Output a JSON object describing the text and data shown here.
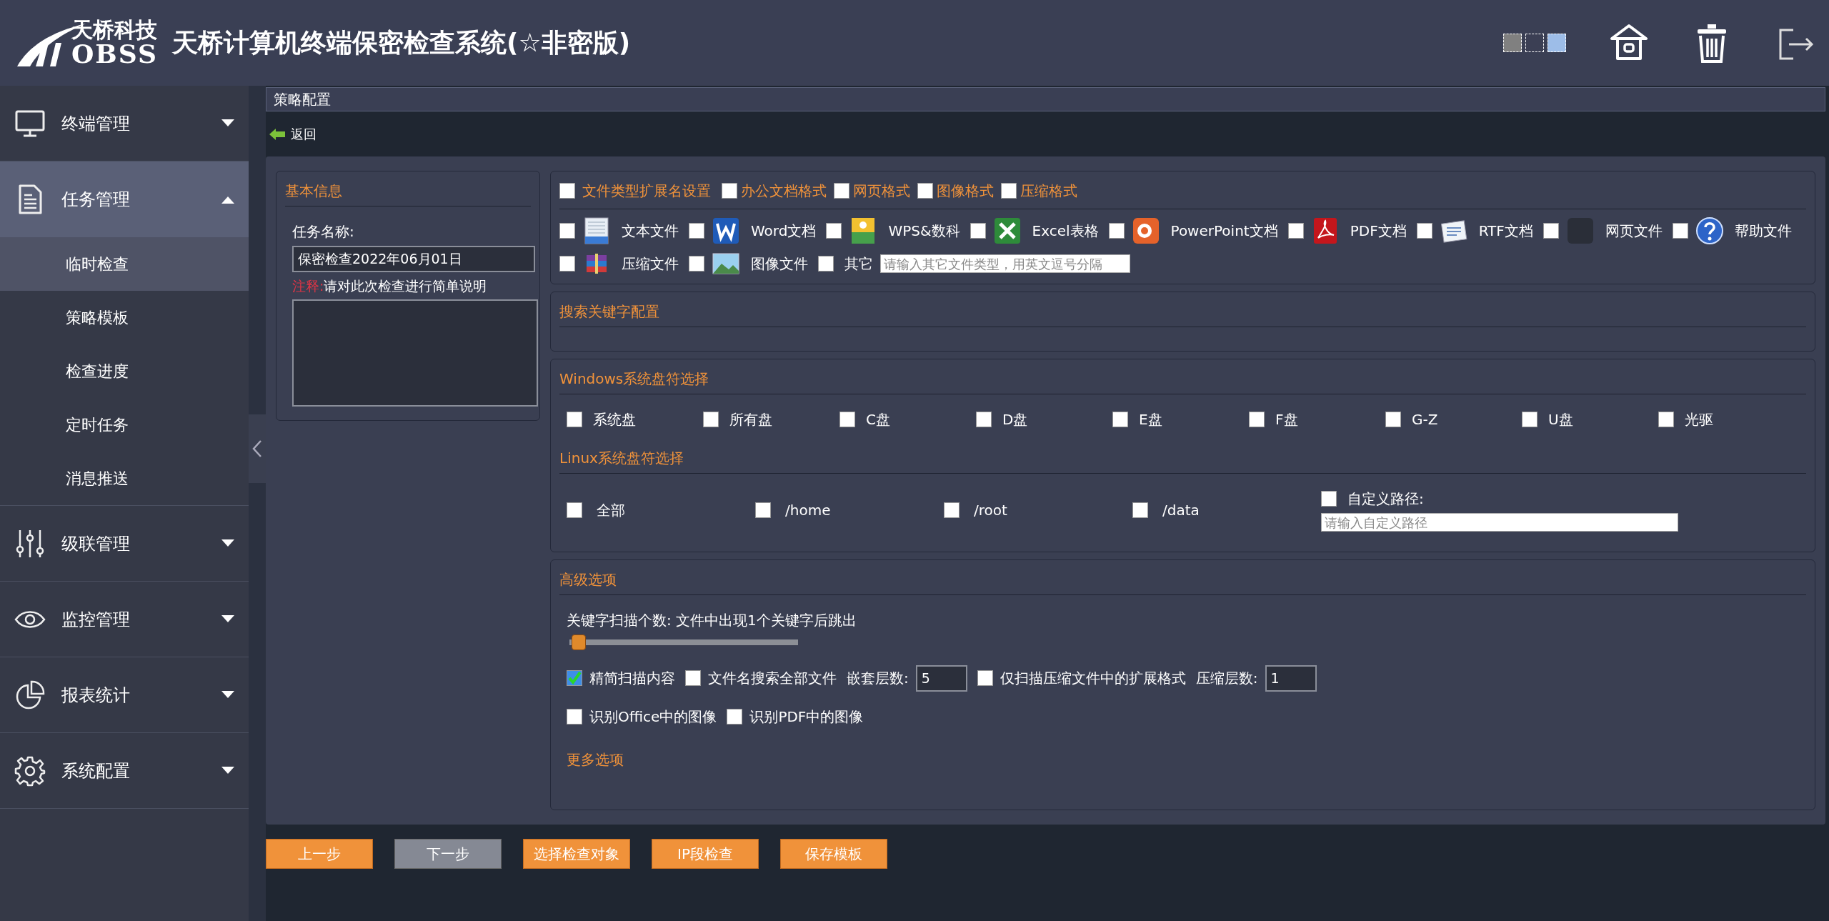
{
  "header": {
    "logo": {
      "brand_cn": "天桥科技",
      "brand_en": "OBSS"
    },
    "title": "天桥计算机终端保密检查系统(☆非密版)",
    "theme_swatches": [
      {
        "color": "#808080"
      },
      {
        "color": "#3b3f54"
      },
      {
        "color": "#9dbde8"
      }
    ],
    "tools": [
      {
        "kind": "home"
      },
      {
        "kind": "trash"
      },
      {
        "kind": "logout"
      }
    ]
  },
  "sidebar": {
    "items": [
      {
        "label": "终端管理",
        "kind": "monitor",
        "expanded": false
      },
      {
        "label": "任务管理",
        "kind": "document",
        "expanded": true,
        "children": [
          {
            "label": "临时检查",
            "selected": true
          },
          {
            "label": "策略模板",
            "selected": false
          },
          {
            "label": "检查进度",
            "selected": false
          },
          {
            "label": "定时任务",
            "selected": false
          },
          {
            "label": "消息推送",
            "selected": false
          }
        ]
      },
      {
        "label": "级联管理",
        "kind": "sliders",
        "expanded": false
      },
      {
        "label": "监控管理",
        "kind": "eye",
        "expanded": false
      },
      {
        "label": "报表统计",
        "kind": "pie",
        "expanded": false
      },
      {
        "label": "系统配置",
        "kind": "gear",
        "expanded": false
      }
    ]
  },
  "breadcrumb": "策略配置",
  "back": "返回",
  "basic_info": {
    "title": "基本信息",
    "task_name_label": "任务名称:",
    "task_name_value": "保密检查2022年06月01日",
    "note_label": "注释:",
    "note_text": "请对此次检查进行简单说明"
  },
  "file_types": {
    "header": {
      "label": "文件类型扩展名设置",
      "checked": false
    },
    "categories": [
      {
        "label": "办公文档格式",
        "checked": false
      },
      {
        "label": "网页格式",
        "checked": false
      },
      {
        "label": "图像格式",
        "checked": false
      },
      {
        "label": "压缩格式",
        "checked": false
      }
    ],
    "types": [
      {
        "label": "文本文件",
        "kind": "txt",
        "checked": false
      },
      {
        "label": "Word文档",
        "kind": "word",
        "checked": false
      },
      {
        "label": "WPS&数科",
        "kind": "wps",
        "checked": false
      },
      {
        "label": "Excel表格",
        "kind": "excel",
        "checked": false
      },
      {
        "label": "PowerPoint文档",
        "kind": "ppt",
        "checked": false
      },
      {
        "label": "PDF文档",
        "kind": "pdf",
        "checked": false
      },
      {
        "label": "RTF文档",
        "kind": "rtf",
        "checked": false
      },
      {
        "label": "网页文件",
        "kind": "html",
        "checked": false
      },
      {
        "label": "帮助文件",
        "kind": "help",
        "checked": false
      },
      {
        "label": "压缩文件",
        "kind": "zip",
        "checked": false
      },
      {
        "label": "图像文件",
        "kind": "image",
        "checked": false
      }
    ],
    "other": {
      "label": "其它",
      "checked": false,
      "placeholder": "请输入其它文件类型，用英文逗号分隔"
    }
  },
  "keywords": {
    "title": "搜索关键字配置"
  },
  "windows_drives": {
    "title": "Windows系统盘符选择",
    "items": [
      {
        "label": "系统盘",
        "checked": false
      },
      {
        "label": "所有盘",
        "checked": false
      },
      {
        "label": "C盘",
        "checked": false
      },
      {
        "label": "D盘",
        "checked": false
      },
      {
        "label": "E盘",
        "checked": false
      },
      {
        "label": "F盘",
        "checked": false
      },
      {
        "label": "G-Z",
        "checked": false
      },
      {
        "label": "U盘",
        "checked": false
      },
      {
        "label": "光驱",
        "checked": false
      }
    ]
  },
  "linux_drives": {
    "title": "Linux系统盘符选择",
    "items": [
      {
        "label": "全部",
        "checked": false
      },
      {
        "label": "/home",
        "checked": false
      },
      {
        "label": "/root",
        "checked": false
      },
      {
        "label": "/data",
        "checked": false
      }
    ],
    "custom_path": {
      "label": "自定义路径:",
      "checked": false,
      "placeholder": "请输入自定义路径"
    }
  },
  "advanced": {
    "title": "高级选项",
    "keyword_count_label": "关键字扫描个数: 文件中出现1个关键字后跳出",
    "level": 0.04,
    "rows": [
      [
        {
          "kind": "checkbox",
          "label": "精简扫描内容",
          "checked": true
        },
        {
          "kind": "checkbox",
          "label": "文件名搜索全部文件",
          "checked": false
        },
        {
          "kind": "number",
          "label": "嵌套层数:",
          "value": "5"
        },
        {
          "kind": "checkbox",
          "label": "仅扫描压缩文件中的扩展格式",
          "checked": false
        },
        {
          "kind": "number",
          "label": "压缩层数:",
          "value": "1"
        }
      ],
      [
        {
          "kind": "checkbox",
          "label": "识别Office中的图像",
          "checked": false
        },
        {
          "kind": "checkbox",
          "label": "识别PDF中的图像",
          "checked": false
        }
      ]
    ],
    "more": "更多选项"
  },
  "buttons": [
    {
      "label": "上一步",
      "disabled": false
    },
    {
      "label": "下一步",
      "disabled": true
    },
    {
      "label": "选择检查对象",
      "disabled": false
    },
    {
      "label": "IP段检查",
      "disabled": false
    },
    {
      "label": "保存模板",
      "disabled": false
    }
  ]
}
